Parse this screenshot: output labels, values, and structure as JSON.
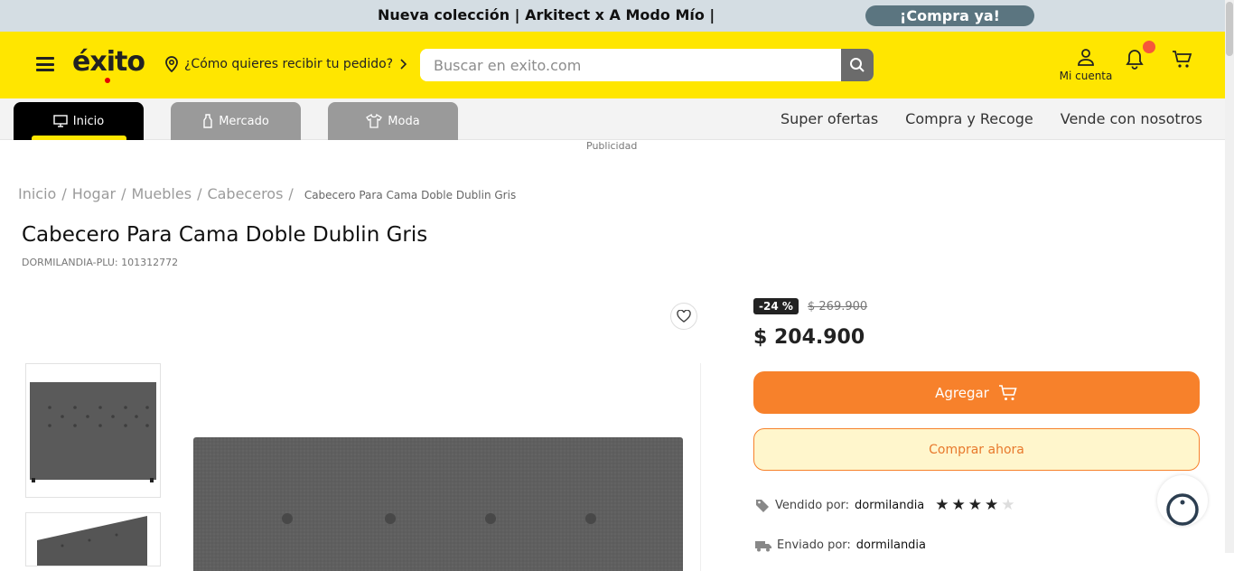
{
  "promo": {
    "text": "Nueva colección | Arkitect x A Modo Mío |",
    "button": "¡Compra ya!"
  },
  "header": {
    "logo": "éxito",
    "delivery": "¿Cómo quieres recibir tu pedido?",
    "search_placeholder": "Buscar en exito.com",
    "account_label": "Mi cuenta"
  },
  "nav": {
    "tabs": [
      {
        "label": "Inicio",
        "icon": "monitor-icon"
      },
      {
        "label": "Mercado",
        "icon": "bottle-icon"
      },
      {
        "label": "Moda",
        "icon": "shirt-icon"
      }
    ],
    "links": [
      "Super ofertas",
      "Compra y Recoge",
      "Vende con nosotros"
    ]
  },
  "ad_label": "Publicidad",
  "breadcrumb": {
    "items": [
      "Inicio",
      "Hogar",
      "Muebles",
      "Cabeceros"
    ],
    "current": "Cabecero Para Cama Doble Dublin Gris"
  },
  "product": {
    "title": "Cabecero Para Cama Doble Dublin Gris",
    "plu": "DORMILANDIA-PLU: 101312772",
    "discount": "-24 %",
    "old_price": "$ 269.900",
    "price": "$ 204.900",
    "add_label": "Agregar",
    "buy_label": "Comprar ahora",
    "sold_by_label": "Vendido por:",
    "seller": "dormilandia",
    "rating": 4,
    "rating_max": 5,
    "shipped_by_label": "Enviado por:",
    "shipper": "dormilandia"
  },
  "colors": {
    "brand_yellow": "#ffe600",
    "accent_orange": "#f7812b",
    "promo_bg": "#d4dde3"
  }
}
